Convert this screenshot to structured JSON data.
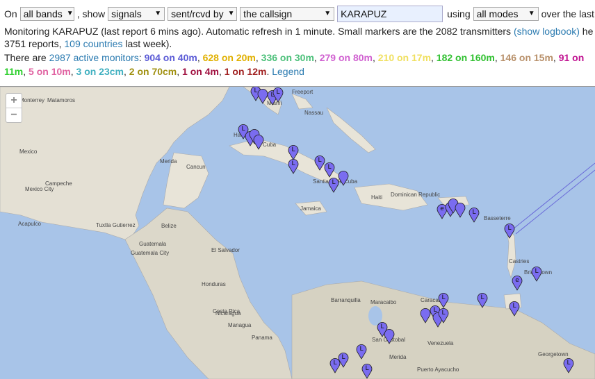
{
  "controls": {
    "on_label": "On",
    "band_select": "all bands",
    "show_label": ", show",
    "show_select": "signals",
    "direction_select": "sent/rcvd by",
    "target_select": "the callsign",
    "callsign_value": "KARAPUZ",
    "using_label": "using",
    "mode_select": "all modes",
    "over_label": "over the last"
  },
  "status": {
    "text1": "Monitoring KARAPUZ (last report 6 mins ago). Automatic refresh in 1 minute. Small markers are the 2082 transmitters ",
    "logbook_link": "(show logbook)",
    "text1_tail": " he",
    "reports_text": "3751 reports, ",
    "countries_link": "109 countries",
    "reports_tail": " last week)."
  },
  "monitors": {
    "prefix": "There are ",
    "active_link": "2987 active monitors",
    "colon": ":",
    "bands": [
      {
        "label": "904 on 40m",
        "color": "#5b5bd6"
      },
      {
        "label": "628 on 20m",
        "color": "#e0b000"
      },
      {
        "label": "336 on 30m",
        "color": "#4cc07a"
      },
      {
        "label": "279 on 80m",
        "color": "#d060d0"
      },
      {
        "label": "210 on 17m",
        "color": "#f0e060"
      },
      {
        "label": "182 on 160m",
        "color": "#30c030"
      },
      {
        "label": "146 on 15m",
        "color": "#b8906a"
      },
      {
        "label": "91 on",
        "color": "#c01090"
      }
    ],
    "bands_row2": [
      {
        "label": "11m",
        "color": "#30d030"
      },
      {
        "label": "5 on 10m",
        "color": "#e060a0"
      },
      {
        "label": "3 on 23cm",
        "color": "#40b0c0"
      },
      {
        "label": "2 on 70cm",
        "color": "#a09010"
      },
      {
        "label": "1 on 4m",
        "color": "#a01040"
      },
      {
        "label": "1 on 12m",
        "color": "#a02020"
      }
    ],
    "legend_link": "Legend"
  },
  "zoom": {
    "plus": "+",
    "minus": "−"
  },
  "map_labels": [
    "Monterrey",
    "Matamoros",
    "Mexico",
    "Mexico City",
    "Campeche",
    "Cancun",
    "Merida",
    "Acapulco",
    "Tuxtla Gutierrez",
    "Guatemala",
    "Guatemala City",
    "Belize",
    "El Salvador",
    "Honduras",
    "Nicaragua",
    "Managua",
    "Costa Rica",
    "Panama",
    "Freeport",
    "Nassau",
    "Havana",
    "Cuba",
    "Santiago de Cuba",
    "Jamaica",
    "Haiti",
    "Dominican Republic",
    "Basseterre",
    "Castries",
    "Bridgetown",
    "Barranquilla",
    "Maracaibo",
    "Caracas",
    "Venezuela",
    "Merida",
    "San Cristobal",
    "Puerto Ayacucho",
    "Georgetown",
    "Miami"
  ]
}
